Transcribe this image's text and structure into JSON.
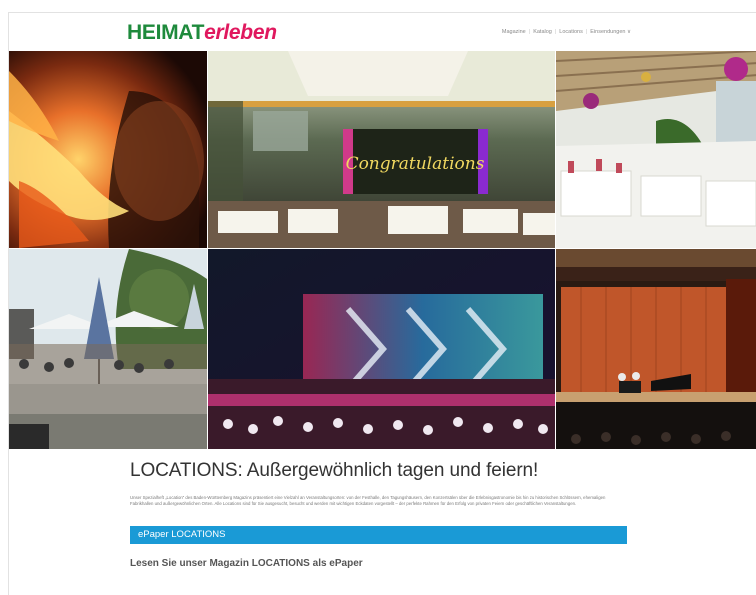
{
  "header": {
    "logo_primary": "HEIMAT",
    "logo_secondary": "erleben",
    "brand_green": "#1e8a3c",
    "brand_pink": "#e0185e",
    "nav": [
      {
        "label": "Magazine"
      },
      {
        "label": "Katalog"
      },
      {
        "label": "Locations"
      },
      {
        "label": "Einsendungen ∨"
      }
    ]
  },
  "gallery": {
    "tiles": [
      {
        "subject": "flame-cooking"
      },
      {
        "subject": "event-hall-stage",
        "stage_text": "Congratulations"
      },
      {
        "subject": "decorated-banquet-hall"
      },
      {
        "subject": "outdoor-garden-party"
      },
      {
        "subject": "illuminated-building-night"
      },
      {
        "subject": "concert-hall-piano"
      }
    ]
  },
  "main": {
    "headline": "LOCATIONS: Außergewöhnlich tagen und feiern!",
    "intro": "Unser Spezialheft „Location“ des Baden-Württemberg Magazins präsentiert eine Vielzahl an Veranstaltungsorten: von der Festhalle, den Tagungshäusern, den Konzertsälen über die Erlebnisgastronomie bis hin zu historischen Schlössern, ehemaligen Fabrikhallen und außergewöhnlichen Orten. Alle Locations sind für Sie ausgesucht, besucht und werden mit wichtigen Eckdaten vorgestellt – der perfekte Rahmen für den Erfolg von privaten Feiern oder geschäftlichen Veranstaltungen.",
    "epaper_label": "ePaper LOCATIONS",
    "epaper_color": "#1a9ad6",
    "subheading": "Lesen Sie unser Magazin LOCATIONS als ePaper"
  }
}
